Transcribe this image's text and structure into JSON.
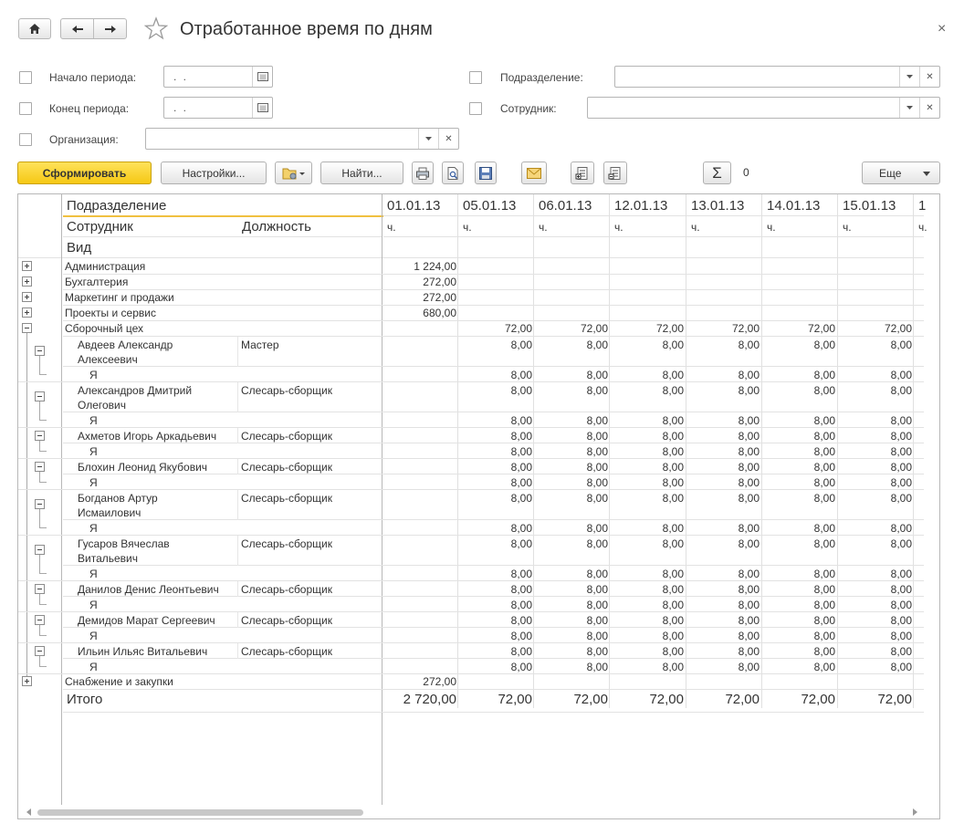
{
  "window": {
    "title": "Отработанное время по дням",
    "close_label": "×"
  },
  "filters": {
    "period_start_label": "Начало периода:",
    "period_start_value": ". .",
    "period_end_label": "Конец периода:",
    "period_end_value": ". .",
    "organization_label": "Организация:",
    "organization_value": "",
    "department_label": "Подразделение:",
    "department_value": "",
    "employee_label": "Сотрудник:",
    "employee_value": ""
  },
  "toolbar": {
    "generate_label": "Сформировать",
    "settings_label": "Настройки...",
    "find_label": "Найти...",
    "sum_label": "Σ",
    "sum_value": "0",
    "more_label": "Еще"
  },
  "colors": {
    "accent_yellow": "#f5c814",
    "header_underline": "#f0c040",
    "grid_line": "#e2e2e2"
  },
  "report": {
    "header": {
      "group1": "Подразделение",
      "employee": "Сотрудник",
      "position": "Должность",
      "kind": "Вид",
      "dates": [
        "01.01.13",
        "05.01.13",
        "06.01.13",
        "12.01.13",
        "13.01.13",
        "14.01.13",
        "15.01.13",
        "1"
      ],
      "units": [
        "ч.",
        "ч.",
        "ч.",
        "ч.",
        "ч.",
        "ч.",
        "ч.",
        "ч."
      ]
    },
    "departments_top": [
      {
        "name": "Администрация",
        "total": "1 224,00"
      },
      {
        "name": "Бухгалтерия",
        "total": "272,00"
      },
      {
        "name": "Маркетинг и продажи",
        "total": "272,00"
      },
      {
        "name": "Проекты и сервис",
        "total": "680,00"
      }
    ],
    "workshop": {
      "name": "Сборочный цех",
      "values": [
        "",
        "72,00",
        "72,00",
        "72,00",
        "72,00",
        "72,00",
        "72,00"
      ]
    },
    "employees": [
      {
        "name1": "Авдеев Александр",
        "name2": "Алексеевич",
        "position": "Мастер",
        "kind": "Я"
      },
      {
        "name1": "Александров Дмитрий",
        "name2": "Олегович",
        "position": "Слесарь-сборщик",
        "kind": "Я"
      },
      {
        "name1": "Ахметов Игорь Аркадьевич",
        "name2": "",
        "position": "Слесарь-сборщик",
        "kind": "Я"
      },
      {
        "name1": "Блохин Леонид Якубович",
        "name2": "",
        "position": "Слесарь-сборщик",
        "kind": "Я"
      },
      {
        "name1": "Богданов Артур",
        "name2": "Исмаилович",
        "position": "Слесарь-сборщик",
        "kind": "Я"
      },
      {
        "name1": "Гусаров Вячеслав",
        "name2": "Витальевич",
        "position": "Слесарь-сборщик",
        "kind": "Я"
      },
      {
        "name1": "Данилов Денис Леонтьевич",
        "name2": "",
        "position": "Слесарь-сборщик",
        "kind": "Я"
      },
      {
        "name1": "Демидов Марат Сергеевич",
        "name2": "",
        "position": "Слесарь-сборщик",
        "kind": "Я"
      },
      {
        "name1": "Ильин Ильяс Витальевич",
        "name2": "",
        "position": "Слесарь-сборщик",
        "kind": "Я"
      }
    ],
    "employee_day_value": "8,00",
    "departments_bottom": [
      {
        "name": "Снабжение и закупки",
        "total": "272,00"
      }
    ],
    "total": {
      "label": "Итого",
      "values": [
        "2 720,00",
        "72,00",
        "72,00",
        "72,00",
        "72,00",
        "72,00",
        "72,00"
      ]
    }
  }
}
